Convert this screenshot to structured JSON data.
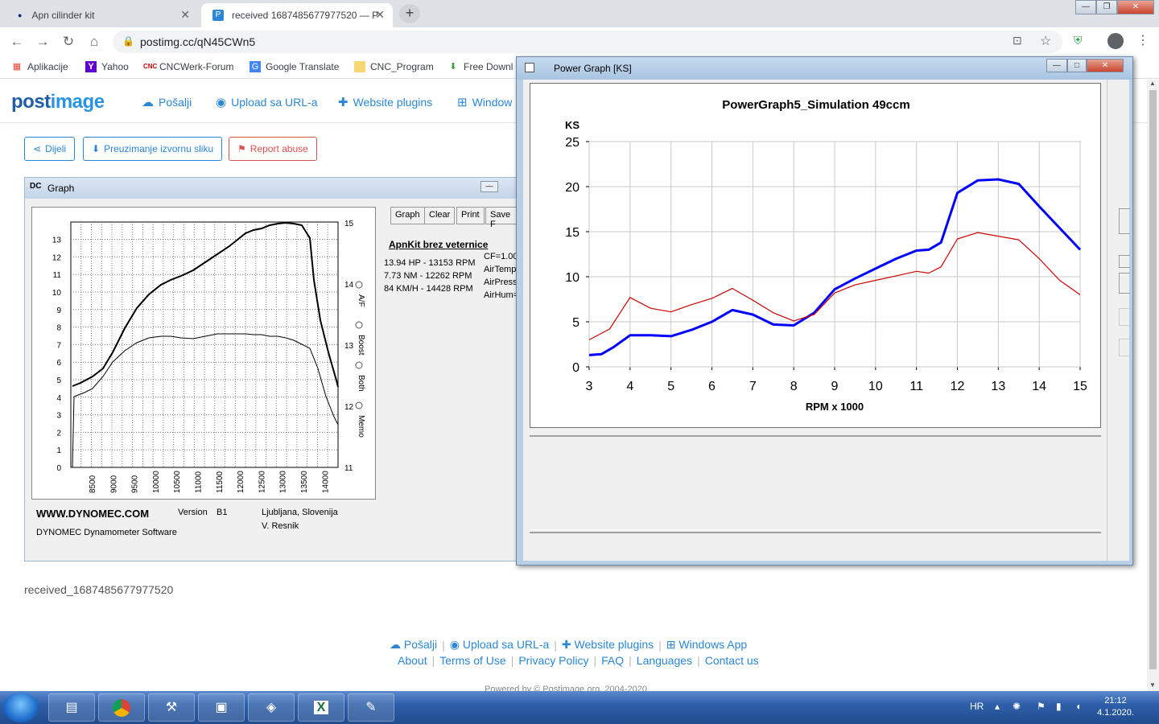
{
  "browser": {
    "tabs": [
      {
        "title": "Apn cilinder kit",
        "active": false
      },
      {
        "title": "received 1687485677977520 — P",
        "active": true
      }
    ],
    "new_tab": "+",
    "url": "postimg.cc/qN45CWn5",
    "window_controls": {
      "minimize": "—",
      "restore": "❐",
      "close": "✕"
    }
  },
  "bookmarks": [
    {
      "label": "Aplikacije",
      "icon": "apps-grid-icon"
    },
    {
      "label": "Yahoo",
      "icon": "yahoo-icon"
    },
    {
      "label": "CNCWerk-Forum",
      "icon": "cnc-icon"
    },
    {
      "label": "Google Translate",
      "icon": "translate-icon"
    },
    {
      "label": "CNC_Program",
      "icon": "folder-icon"
    },
    {
      "label": "Free Downl",
      "icon": "download-icon"
    }
  ],
  "site": {
    "logo": {
      "part1": "post",
      "part2": "image"
    },
    "nav": [
      {
        "label": "Pošalji",
        "icon": "cloud-upload-icon"
      },
      {
        "label": "Upload sa URL-a",
        "icon": "globe-icon"
      },
      {
        "label": "Website plugins",
        "icon": "puzzle-icon"
      },
      {
        "label": "Window",
        "icon": "windows-icon"
      }
    ],
    "actions": [
      {
        "label": "Dijeli",
        "icon": "share-icon"
      },
      {
        "label": "Preuzimanje izvornu sliku",
        "icon": "download-icon"
      },
      {
        "label": "Report abuse",
        "icon": "flag-icon"
      }
    ],
    "filename": "received_1687485677977520",
    "footer_row1": [
      "Pošalji",
      "Upload sa URL-a",
      "Website plugins",
      "Windows App"
    ],
    "footer_row2": [
      "About",
      "Terms of Use",
      "Privacy Policy",
      "FAQ",
      "Languages",
      "Contact us"
    ],
    "footer_partial": "Powered by © Postimage.org, 2004-2020"
  },
  "dynomec": {
    "title": "Graph",
    "buttons": [
      "Graph",
      "Clear",
      "Print",
      "Save F"
    ],
    "run_name": "ApnKit brez veternice",
    "results": [
      "13.94 HP - 13153 RPM",
      "7.73 NM - 12262 RPM",
      "84 KM/H - 14428 RPM"
    ],
    "conditions": [
      "CF=1.00",
      "AirTemp",
      "AirPress",
      "AirHum="
    ],
    "radio_options": [
      "A/F",
      "Boost",
      "Both",
      "Memo"
    ],
    "y_left_ticks": [
      "0",
      "1",
      "2",
      "3",
      "4",
      "5",
      "6",
      "7",
      "8",
      "9",
      "10",
      "11",
      "12",
      "13"
    ],
    "y_right_ticks": [
      "11",
      "12",
      "13",
      "14",
      "15"
    ],
    "x_ticks": [
      "8500",
      "9000",
      "9500",
      "10000",
      "10500",
      "11000",
      "11500",
      "12000",
      "12500",
      "13000",
      "13500",
      "14000"
    ],
    "brand": "WWW.DYNOMEC.COM",
    "version_label": "Version",
    "version_value": "B1",
    "location": "Ljubljana, Slovenija",
    "author": "V. Resnik",
    "software": "DYNOMEC Dynamometer Software"
  },
  "power_graph": {
    "window_title": "Power Graph  [KS]"
  },
  "chart_data": {
    "type": "line",
    "title": "PowerGraph5_Simulation  49ccm",
    "xlabel": "RPM x 1000",
    "ylabel": "KS",
    "xlim": [
      3,
      15
    ],
    "ylim": [
      0,
      25
    ],
    "x_ticks": [
      "3",
      "4",
      "5",
      "6",
      "7",
      "8",
      "9",
      "10",
      "11",
      "12",
      "13",
      "14",
      "15"
    ],
    "y_ticks": [
      "0",
      "5",
      "10",
      "15",
      "20",
      "25"
    ],
    "grid": true,
    "series": [
      {
        "color": "#0000ff",
        "x": [
          3,
          3.3,
          3.6,
          4,
          4.5,
          5,
          5.5,
          6,
          6.5,
          7,
          7.5,
          8,
          8.5,
          9,
          9.5,
          10,
          10.5,
          11,
          11.3,
          11.6,
          12,
          12.5,
          13,
          13.5,
          14,
          14.5,
          15
        ],
        "values": [
          1.3,
          1.4,
          2.2,
          3.5,
          3.5,
          3.4,
          4.1,
          5.0,
          6.3,
          5.8,
          4.7,
          4.6,
          6.0,
          8.6,
          9.8,
          10.9,
          12.0,
          12.9,
          13.0,
          13.8,
          19.3,
          20.7,
          20.8,
          20.3,
          17.8,
          15.4,
          13.0
        ]
      },
      {
        "color": "#cc0000",
        "x": [
          3,
          3.5,
          4,
          4.5,
          5,
          5.5,
          6,
          6.5,
          7,
          7.5,
          8,
          8.5,
          9,
          9.5,
          10,
          10.5,
          11,
          11.3,
          11.6,
          12,
          12.5,
          13,
          13.5,
          14,
          14.5,
          15
        ],
        "values": [
          3.0,
          4.2,
          7.7,
          6.5,
          6.1,
          6.9,
          7.6,
          8.7,
          7.4,
          6.0,
          5.1,
          5.8,
          8.2,
          9.1,
          9.6,
          10.1,
          10.6,
          10.4,
          11.1,
          14.2,
          14.9,
          14.5,
          14.1,
          12.0,
          9.6,
          8.0
        ]
      }
    ]
  },
  "taskbar": {
    "apps": [
      {
        "name": "explorer",
        "icon": "folder-icon"
      },
      {
        "name": "chrome",
        "icon": "chrome-icon"
      },
      {
        "name": "tools",
        "icon": "tools-icon"
      },
      {
        "name": "cnc",
        "icon": "monitor-icon"
      },
      {
        "name": "app32",
        "icon": "app-icon"
      },
      {
        "name": "excel",
        "icon": "excel-icon"
      },
      {
        "name": "notepad",
        "icon": "notepad-icon"
      }
    ],
    "language": "HR",
    "time": "21:12",
    "date": "4.1.2020."
  }
}
